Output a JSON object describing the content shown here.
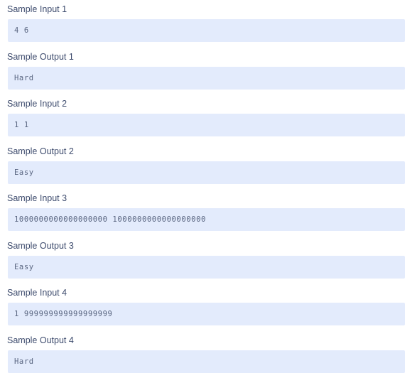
{
  "samples": [
    {
      "label": "Sample Input 1",
      "value": "4 6"
    },
    {
      "label": "Sample Output 1",
      "value": "Hard"
    },
    {
      "label": "Sample Input 2",
      "value": "1 1"
    },
    {
      "label": "Sample Output 2",
      "value": "Easy"
    },
    {
      "label": "Sample Input 3",
      "value": "1000000000000000000 1000000000000000000"
    },
    {
      "label": "Sample Output 3",
      "value": "Easy"
    },
    {
      "label": "Sample Input 4",
      "value": "1 999999999999999999"
    },
    {
      "label": "Sample Output 4",
      "value": "Hard"
    }
  ],
  "colors": {
    "label_text": "#3d4b6d",
    "box_background": "#e3ebfc",
    "value_text": "#5b6782"
  }
}
